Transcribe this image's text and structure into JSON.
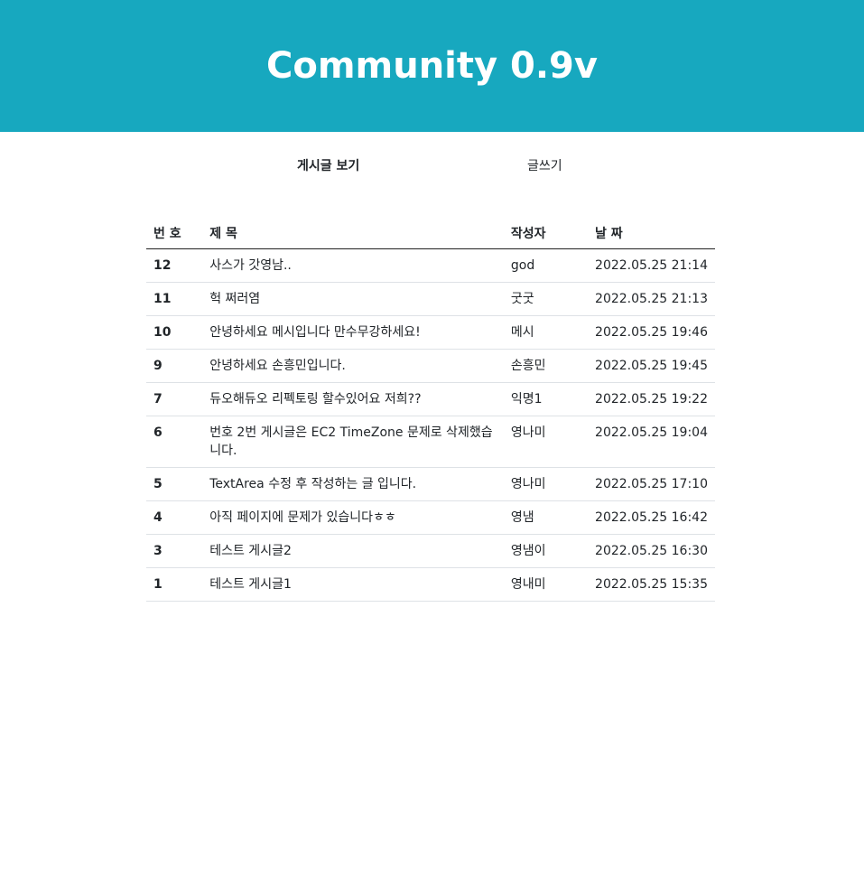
{
  "header": {
    "title": "Community 0.9v"
  },
  "nav": {
    "view_label": "게시글 보기",
    "write_label": "글쓰기"
  },
  "table": {
    "headers": {
      "num": "번 호",
      "title": "제 목",
      "author": "작성자",
      "date": "날 짜"
    },
    "rows": [
      {
        "num": "12",
        "title": "사스가 갓영남..",
        "author": "god",
        "date": "2022.05.25 21:14"
      },
      {
        "num": "11",
        "title": "헉 쩌러염",
        "author": "굿굿",
        "date": "2022.05.25 21:13"
      },
      {
        "num": "10",
        "title": "안녕하세요 메시입니다 만수무강하세요!",
        "author": "메시",
        "date": "2022.05.25 19:46"
      },
      {
        "num": "9",
        "title": "안녕하세요 손흥민입니다.",
        "author": "손흥민",
        "date": "2022.05.25 19:45"
      },
      {
        "num": "7",
        "title": "듀오해듀오 리펙토링 할수있어요 저희??",
        "author": "익명1",
        "date": "2022.05.25 19:22"
      },
      {
        "num": "6",
        "title": "번호 2번 게시글은 EC2 TimeZone 문제로 삭제했습니다.",
        "author": "영나미",
        "date": "2022.05.25 19:04"
      },
      {
        "num": "5",
        "title": "TextArea 수정 후 작성하는 글 입니다.",
        "author": "영나미",
        "date": "2022.05.25 17:10"
      },
      {
        "num": "4",
        "title": "아직 페이지에 문제가 있습니다ㅎㅎ",
        "author": "영냄",
        "date": "2022.05.25 16:42"
      },
      {
        "num": "3",
        "title": "테스트 게시글2",
        "author": "영냄이",
        "date": "2022.05.25 16:30"
      },
      {
        "num": "1",
        "title": "테스트 게시글1",
        "author": "영내미",
        "date": "2022.05.25 15:35"
      }
    ]
  }
}
